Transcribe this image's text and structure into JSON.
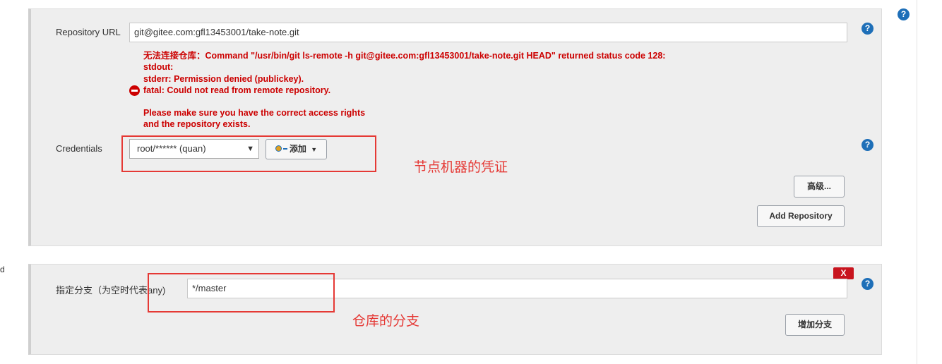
{
  "repository": {
    "url_label": "Repository URL",
    "url_value": "git@gitee.com:gfl13453001/take-note.git",
    "error_lines": [
      "无法连接仓库：Command \"/usr/bin/git ls-remote -h git@gitee.com:gfl13453001/take-note.git HEAD\" returned status code 128:",
      "stdout:",
      "stderr: Permission denied (publickey).",
      "fatal: Could not read from remote repository.",
      "",
      "Please make sure you have the correct access rights",
      "and the repository exists."
    ],
    "credentials_label": "Credentials",
    "credentials_selected": "root/****** (quan)",
    "add_button": "添加",
    "advanced_button": "高级...",
    "add_repository_button": "Add Repository"
  },
  "branch": {
    "label": "指定分支（为空时代表any)",
    "value": "*/master",
    "delete_button": "X",
    "add_branch_button": "增加分支"
  },
  "annotations": {
    "credentials_note": "节点机器的凭证",
    "branch_note": "仓库的分支"
  },
  "side_fragment": "d",
  "help_icon_text": "?",
  "colors": {
    "error": "#cc0000",
    "annotation": "#e53935",
    "help": "#1e6fb8",
    "delete": "#c8141e"
  }
}
